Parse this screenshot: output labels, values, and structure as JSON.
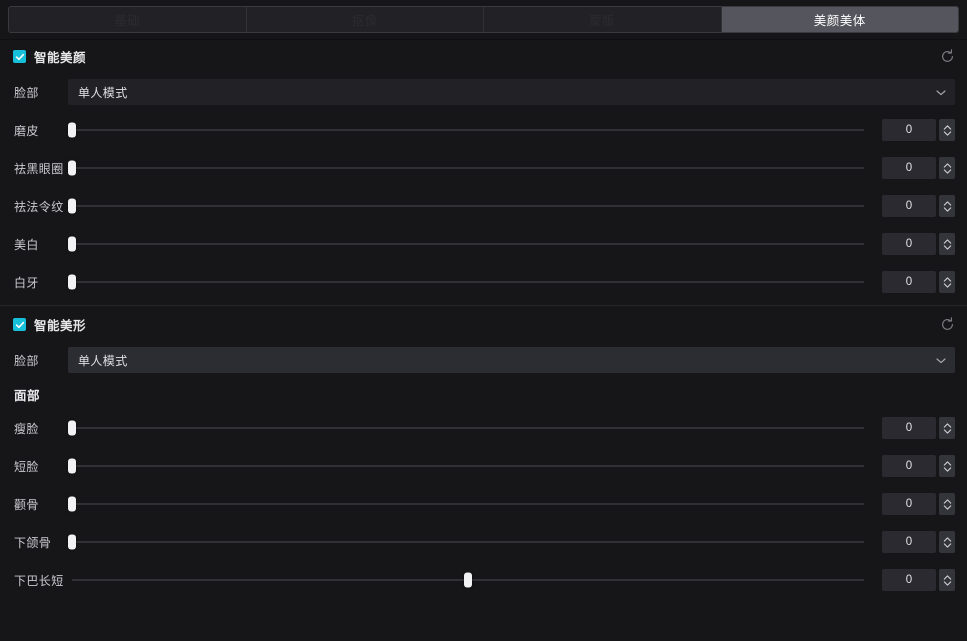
{
  "tabs": [
    {
      "label": "基础",
      "active": false
    },
    {
      "label": "抠像",
      "active": false
    },
    {
      "label": "蒙版",
      "active": false
    },
    {
      "label": "美颜美体",
      "active": true
    }
  ],
  "accent_color": "#16c0d8",
  "sections": [
    {
      "title": "智能美颜",
      "checked": true,
      "reset_icon": "reset-circular-arrow-icon",
      "dropdown": {
        "label": "脸部",
        "value": "单人模式",
        "chevron_icon": "chevron-down-icon",
        "hover": false
      },
      "sliders": [
        {
          "label": "磨皮",
          "value": "0",
          "percent": 0,
          "bipolar": false
        },
        {
          "label": "祛黑眼圈",
          "value": "0",
          "percent": 0,
          "bipolar": false
        },
        {
          "label": "祛法令纹",
          "value": "0",
          "percent": 0,
          "bipolar": false
        },
        {
          "label": "美白",
          "value": "0",
          "percent": 0,
          "bipolar": false
        },
        {
          "label": "白牙",
          "value": "0",
          "percent": 0,
          "bipolar": false
        }
      ]
    },
    {
      "title": "智能美形",
      "checked": true,
      "reset_icon": "reset-circular-arrow-icon",
      "dropdown": {
        "label": "脸部",
        "value": "单人模式",
        "chevron_icon": "chevron-down-icon",
        "hover": true
      },
      "subhead": "面部",
      "sliders": [
        {
          "label": "瘦脸",
          "value": "0",
          "percent": 0,
          "bipolar": false
        },
        {
          "label": "短脸",
          "value": "0",
          "percent": 0,
          "bipolar": false
        },
        {
          "label": "颧骨",
          "value": "0",
          "percent": 0,
          "bipolar": false
        },
        {
          "label": "下颌骨",
          "value": "0",
          "percent": 0,
          "bipolar": false
        },
        {
          "label": "下巴长短",
          "value": "0",
          "percent": 50,
          "bipolar": true
        }
      ]
    }
  ]
}
